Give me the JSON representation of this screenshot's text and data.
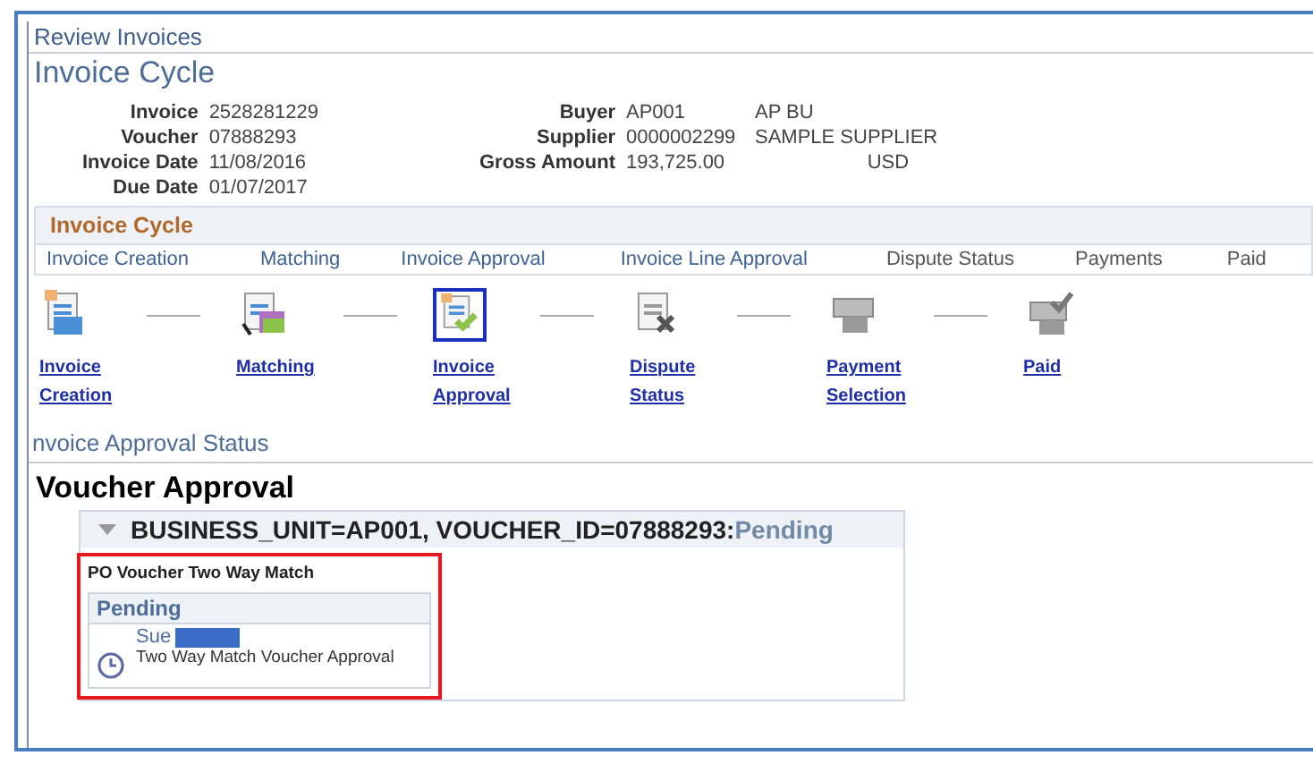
{
  "breadcrumb": "Review Invoices",
  "title": "Invoice Cycle",
  "fields_left": [
    {
      "label": "Invoice",
      "value": "2528281229"
    },
    {
      "label": "Voucher",
      "value": "07888293"
    },
    {
      "label": "Invoice Date",
      "value": "11/08/2016"
    },
    {
      "label": "Due Date",
      "value": "01/07/2017"
    }
  ],
  "fields_right": [
    {
      "label": "Buyer",
      "value": "AP001",
      "extra": "AP BU"
    },
    {
      "label": "Supplier",
      "value": "0000002299",
      "extra": "SAMPLE SUPPLIER"
    },
    {
      "label": "Gross Amount",
      "value": "193,725.00",
      "extra": "USD"
    }
  ],
  "cycle": {
    "heading": "Invoice Cycle",
    "stages": [
      {
        "label": "Invoice Creation",
        "active": true
      },
      {
        "label": "Matching",
        "active": true
      },
      {
        "label": "Invoice Approval",
        "active": true
      },
      {
        "label": "Invoice Line Approval",
        "active": true
      },
      {
        "label": "Dispute Status",
        "active": false
      },
      {
        "label": "Payments",
        "active": false
      },
      {
        "label": "Paid",
        "active": false
      }
    ],
    "steps": [
      {
        "kind": "creation",
        "lines": [
          "Invoice",
          "Creation"
        ],
        "active": true,
        "selected": false
      },
      {
        "kind": "matching",
        "lines": [
          "Matching"
        ],
        "active": true,
        "selected": false
      },
      {
        "kind": "approval",
        "lines": [
          "Invoice",
          "Approval"
        ],
        "active": true,
        "selected": true
      },
      {
        "kind": "dispute",
        "lines": [
          "Dispute",
          "Status"
        ],
        "active": false,
        "selected": false
      },
      {
        "kind": "payment",
        "lines": [
          "Payment",
          "Selection"
        ],
        "active": false,
        "selected": false
      },
      {
        "kind": "paid",
        "lines": [
          "Paid"
        ],
        "active": false,
        "selected": false
      }
    ]
  },
  "status_section": {
    "heading": "nvoice Approval Status",
    "title": "Voucher Approval",
    "group": {
      "expanded": true,
      "key": "BUSINESS_UNIT=AP001, VOUCHER_ID=07888293:",
      "status": "Pending",
      "process": "PO Voucher Two Way Match",
      "stage_status": "Pending",
      "approver": "Sue",
      "step": "Two Way Match Voucher Approval"
    }
  }
}
